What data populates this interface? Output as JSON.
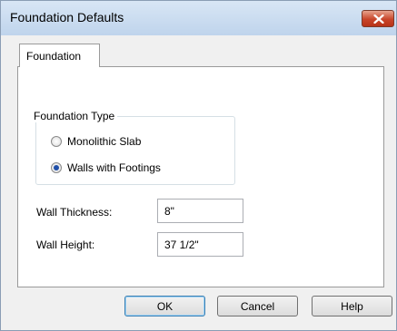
{
  "window": {
    "title": "Foundation Defaults"
  },
  "tabs": [
    {
      "label": "Foundation",
      "selected": true
    }
  ],
  "foundation_type": {
    "legend": "Foundation Type",
    "options": [
      {
        "label": "Monolithic Slab",
        "checked": false
      },
      {
        "label": "Walls with Footings",
        "checked": true
      }
    ]
  },
  "fields": {
    "wall_thickness": {
      "label": "Wall Thickness:",
      "value": "8\""
    },
    "wall_height": {
      "label": "Wall Height:",
      "value": "37 1/2\""
    }
  },
  "buttons": {
    "ok": "OK",
    "cancel": "Cancel",
    "help": "Help"
  },
  "icons": {
    "close": "close-icon"
  },
  "colors": {
    "close_button": "#c8452a",
    "title_bar": "#bfd4ec",
    "default_button_border": "#3c7fb1"
  }
}
